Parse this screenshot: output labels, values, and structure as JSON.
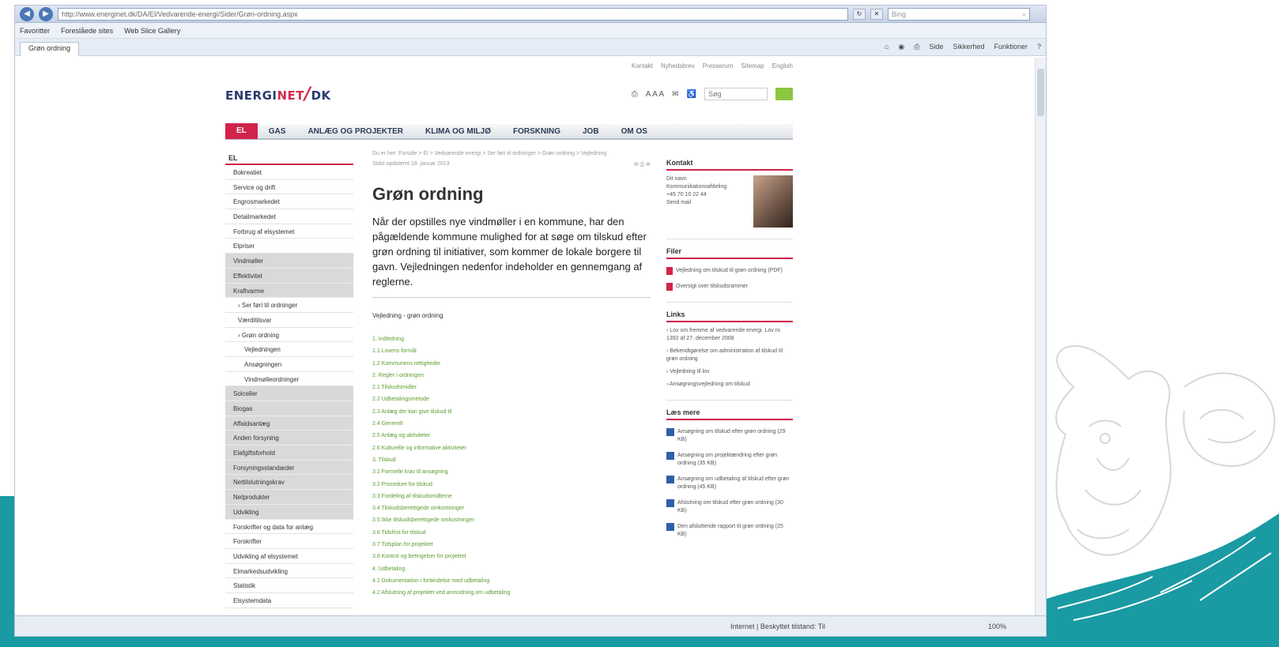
{
  "browser": {
    "address": "http://www.energinet.dk/DA/El/Vedvarende-energi/Sider/Grøn-ordning.aspx",
    "search_placeholder": "Bing",
    "favorites_label": "Favoritter",
    "fav_items": [
      "Foreslåede sites",
      "Web Slice Gallery"
    ],
    "tab_label": "Grøn ordning",
    "commands": [
      "Side",
      "Sikkerhed",
      "Funktioner"
    ],
    "status_zone": "Internet | Beskyttet tilstand: Til",
    "zoom": "100%"
  },
  "site": {
    "logo_part1": "ENERGI",
    "logo_part2": "NET",
    "logo_slash": "/",
    "logo_part3": "DK",
    "util_links": [
      "Kontakt",
      "Nyhedsbrev",
      "Presserum",
      "Sitemap",
      "English"
    ],
    "text_size": "A A A",
    "search_placeholder": "Søg",
    "nav": [
      "EL",
      "GAS",
      "ANLÆG OG PROJEKTER",
      "KLIMA OG MILJØ",
      "FORSKNING",
      "JOB",
      "OM OS"
    ]
  },
  "left_nav": {
    "head": "EL",
    "items": [
      {
        "label": "Bokreatiet",
        "style": "plain"
      },
      {
        "label": "Service og drift",
        "style": "plain"
      },
      {
        "label": "Engrosmarkedet",
        "style": "plain"
      },
      {
        "label": "Detailmarkedet",
        "style": "plain"
      },
      {
        "label": "Forbrug af elsystemet",
        "style": "plain"
      },
      {
        "label": "Elpriser",
        "style": "plain"
      },
      {
        "label": "Vindmøller",
        "style": "grey"
      },
      {
        "label": "Effektivitet",
        "style": "grey"
      },
      {
        "label": "Kraftvarme",
        "style": "grey"
      },
      {
        "label": "› Ser føri til ordninger",
        "style": "indent"
      },
      {
        "label": "Værditilsvar",
        "style": "indent"
      },
      {
        "label": "› Grøn ordning",
        "style": "indent"
      },
      {
        "label": "Vejledningen",
        "style": "indent2"
      },
      {
        "label": "Ansøgningen",
        "style": "indent2"
      },
      {
        "label": "Vindmølleordninger",
        "style": "indent2"
      },
      {
        "label": "Solceller",
        "style": "grey"
      },
      {
        "label": "Biogas",
        "style": "grey"
      },
      {
        "label": "Affaldsanlæg",
        "style": "grey"
      },
      {
        "label": "Anden forsyning",
        "style": "grey"
      },
      {
        "label": "Elafgiftsforhold",
        "style": "grey"
      },
      {
        "label": "Forsyningsstandarder",
        "style": "grey"
      },
      {
        "label": "Nettilslutningskrav",
        "style": "grey"
      },
      {
        "label": "Netprodukter",
        "style": "grey"
      },
      {
        "label": "Udvikling",
        "style": "grey"
      },
      {
        "label": "Forskrifter og data for anlæg",
        "style": "plain"
      },
      {
        "label": "Forskrifter",
        "style": "plain"
      },
      {
        "label": "Udvikling af elsystemet",
        "style": "plain"
      },
      {
        "label": "Elmarkedsudvikling",
        "style": "plain"
      },
      {
        "label": "Statistik",
        "style": "plain"
      },
      {
        "label": "Elsystemdata",
        "style": "plain"
      }
    ]
  },
  "main": {
    "breadcrumb": "Du er her: Forside > El > Vedvarende energi > Ser føri til ordninger > Grøn ordning > Vejledning",
    "date": "Sidst opdateret 18. januar 2013",
    "title": "Grøn ordning",
    "lead": "Når der opstilles nye vindmøller i en kommune, har den pågældende kommune mulighed for at søge om tilskud efter grøn ordning til initiativer, som kommer de lokale borgere til gavn. Vejledningen nedenfor indeholder en gennemgang af reglerne.",
    "toc_head": "Vejledning - grøn ordning",
    "toc": [
      "1. Indledning",
      "1.1 Lovens formål",
      "1.2 Kommunens rettigheder",
      "2. Regler i ordningen",
      "2.1 Tilskudsmidler",
      "2.2 Udbetalingsmetode",
      "2.3 Anlæg der kan give tilskud til",
      "2.4 Generelt",
      "2.5 Anlæg og aktiviteter",
      "2.6 Kulturelle og informative aktiviteter",
      "3. Tilskud",
      "3.1 Formelle krav til ansøgning",
      "3.2 Procedure for tilskud",
      "3.3 Fordeling af tilskudsmidlerne",
      "3.4 Tilskudsberettigede omkostninger",
      "3.5 Ikke tilskudsberettigede omkostninger",
      "3.6 Tidsfrist for tilskud",
      "3.7 Tidsplan for projektet",
      "3.8 Kontrol og betingelser for projektet",
      "4. Udbetaling",
      "4.1 Dokumentation i forbindelse med udbetaling",
      "4.2 Afslutning af projektet ved anmodning om udbetaling"
    ]
  },
  "right": {
    "contact_head": "Kontakt",
    "contact_lines": [
      "Dit navn",
      "Kommunikationsafdeling",
      "+45 70 10 22 44",
      "Send mail"
    ],
    "files_head": "Filer",
    "files": [
      "Vejledning om tilskud til grøn ordning (PDF)",
      "Oversigt over tilskudsrammer"
    ],
    "links_head": "Links",
    "links": [
      "› Lov om fremme af vedvarende energi. Lov nr. 1392 af 27. december 2008",
      "› Bekendtgørelse om administration af tilskud til grøn ordning",
      "› Vejledning til lov",
      "› Ansøgningsvejledning om tilskud"
    ],
    "more_head": "Læs mere",
    "more": [
      "Ansøgning om tilskud efter grøn ordning (29 KB)",
      "Ansøgning om projektændring efter grøn ordning (35 KB)",
      "Ansøgning om udbetaling af tilskud efter grøn ordning (45 KB)",
      "Afslutning om tilskud efter grøn ordning (30 KB)",
      "Den afsluttende rapport til grøn ordning (25 KB)"
    ]
  },
  "colors": {
    "accent_red": "#d1234b",
    "link_green": "#5c9c2e",
    "teal": "#1a9aa3"
  }
}
